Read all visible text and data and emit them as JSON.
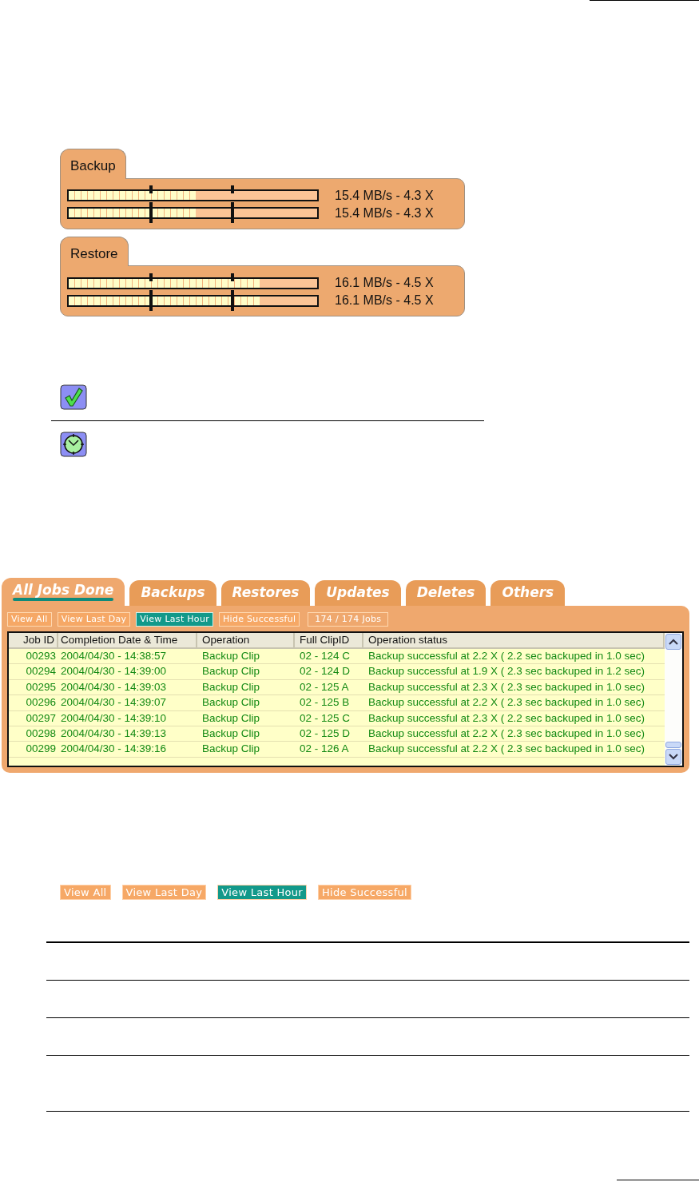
{
  "meters": [
    {
      "label": "Backup",
      "channels": [
        {
          "level": 0.51,
          "reading": "15.4 MB/s - 4.3 X"
        },
        {
          "level": 0.51,
          "reading": "15.4 MB/s - 4.3 X"
        }
      ]
    },
    {
      "label": "Restore",
      "channels": [
        {
          "level": 0.77,
          "reading": "16.1 MB/s - 4.5 X"
        },
        {
          "level": 0.77,
          "reading": "16.1 MB/s - 4.5 X"
        }
      ]
    }
  ],
  "jobs_panel": {
    "tabs": [
      {
        "label": "All Jobs Done",
        "selected": true
      },
      {
        "label": "Backups",
        "selected": false
      },
      {
        "label": "Restores",
        "selected": false
      },
      {
        "label": "Updates",
        "selected": false
      },
      {
        "label": "Deletes",
        "selected": false
      },
      {
        "label": "Others",
        "selected": false
      }
    ],
    "filters": [
      {
        "label": "View All",
        "selected": false
      },
      {
        "label": "View Last Day",
        "selected": false
      },
      {
        "label": "View Last Hour",
        "selected": true
      },
      {
        "label": "Hide Successful",
        "selected": false
      }
    ],
    "job_count": "174 / 174 Jobs",
    "table": {
      "columns": [
        "Job ID",
        "Completion Date & Time",
        "Operation",
        "Full ClipID",
        "Operation status"
      ],
      "rows": [
        [
          "00293",
          "2004/04/30 - 14:38:57",
          "Backup Clip",
          "02 - 124 C",
          "Backup successful at 2.2 X ( 2.2 sec backuped in 1.0 sec)"
        ],
        [
          "00294",
          "2004/04/30 - 14:39:00",
          "Backup Clip",
          "02 - 124 D",
          "Backup successful at 1.9 X ( 2.3 sec backuped in 1.2 sec)"
        ],
        [
          "00295",
          "2004/04/30 - 14:39:03",
          "Backup Clip",
          "02 - 125 A",
          "Backup successful at 2.3 X ( 2.3 sec backuped in 1.0 sec)"
        ],
        [
          "00296",
          "2004/04/30 - 14:39:07",
          "Backup Clip",
          "02 - 125 B",
          "Backup successful at 2.2 X ( 2.3 sec backuped in 1.0 sec)"
        ],
        [
          "00297",
          "2004/04/30 - 14:39:10",
          "Backup Clip",
          "02 - 125 C",
          "Backup successful at 2.3 X ( 2.2 sec backuped in 1.0 sec)"
        ],
        [
          "00298",
          "2004/04/30 - 14:39:13",
          "Backup Clip",
          "02 - 125 D",
          "Backup successful at 2.2 X ( 2.3 sec backuped in 1.0 sec)"
        ],
        [
          "00299",
          "2004/04/30 - 14:39:16",
          "Backup Clip",
          "02 - 126 A",
          "Backup successful at 2.2 X ( 2.3 sec backuped in 1.0 sec)"
        ]
      ]
    }
  },
  "filters_example": [
    {
      "label": "View All",
      "selected": false
    },
    {
      "label": "View Last Day",
      "selected": false
    },
    {
      "label": "View Last Hour",
      "selected": true
    },
    {
      "label": "Hide Successful",
      "selected": false
    }
  ]
}
